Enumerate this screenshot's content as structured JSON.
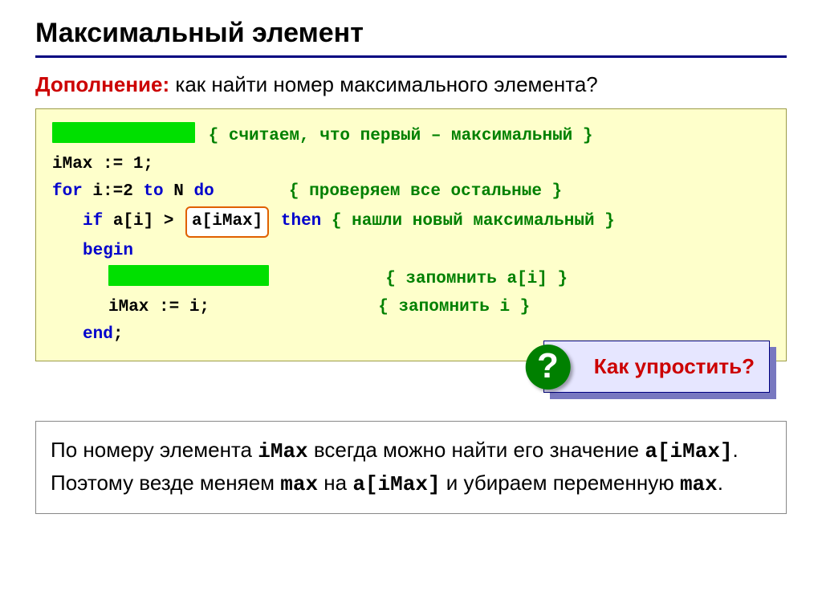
{
  "title": "Максимальный элемент",
  "subhead": {
    "lead": "Дополнение:",
    "rest": " как найти номер максимального элемента?"
  },
  "code": {
    "c1": "{ считаем, что первый – максимальный }",
    "l2": "iMax := 1;",
    "l3a": "for",
    "l3b": " i:=2 ",
    "l3c": "to",
    "l3d": " N ",
    "l3e": "do",
    "c3": "{ проверяем все остальные }",
    "l4a": "if",
    "l4b": " a[i] > ",
    "hl": "a[iMax]",
    "l4c": "then",
    "c4": "{ нашли новый максимальный }",
    "l5": "begin",
    "c6": "{ запомнить a[i] }",
    "l7": "iMax := i;",
    "c7": "{ запомнить i }",
    "l8": "end",
    "l8p": ";"
  },
  "callout": {
    "qmark": "?",
    "text": "Как упростить?"
  },
  "note": {
    "t1": "По номеру элемента ",
    "m1": "iMax",
    "t2": " всегда можно найти его значение ",
    "m2": "a[iMax]",
    "t3": ". Поэтому везде меняем ",
    "m3": "max",
    "t4": " на ",
    "m4": "a[iMax]",
    "t5": " и убираем переменную ",
    "m5": "max",
    "t6": "."
  }
}
